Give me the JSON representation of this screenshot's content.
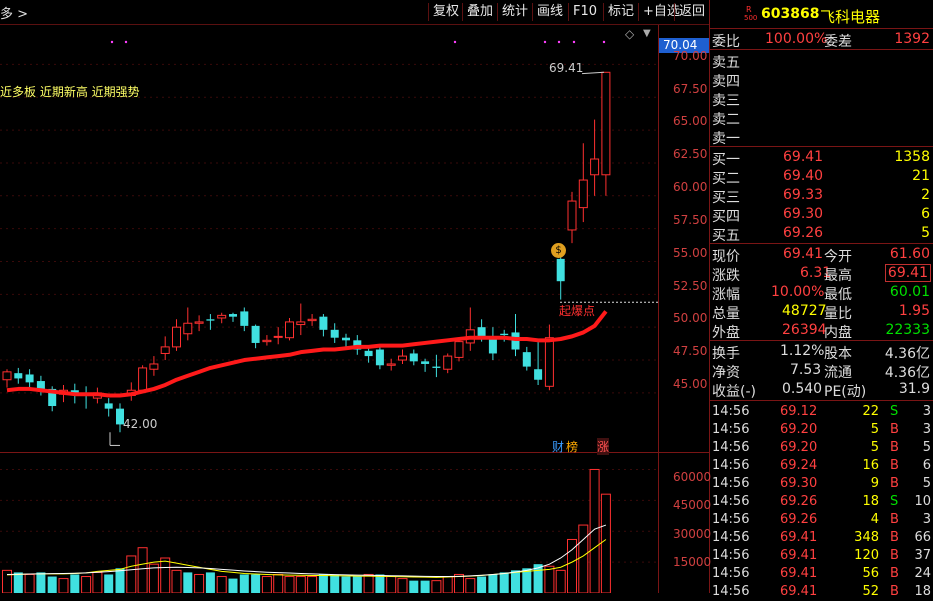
{
  "toolbar": {
    "left_label": "多 >",
    "buttons": [
      "复权",
      "叠加",
      "统计",
      "画线",
      "F10",
      "标记",
      "+自选",
      "返回"
    ]
  },
  "chart": {
    "current_price_tag": "70.04",
    "signal_text": "近多板 近期新高 近期强势",
    "high_label": "69.41",
    "low_label": "42.00",
    "breakout_label": "起爆点",
    "badge_cai": "财",
    "badge_bang": "榜",
    "badge_zhang": "涨",
    "price_axis": [
      "70.00",
      "67.50",
      "65.00",
      "62.50",
      "60.00",
      "57.50",
      "55.00",
      "52.50",
      "50.00",
      "47.50",
      "45.00"
    ],
    "volume_axis": [
      "60000",
      "45000",
      "30000",
      "15000"
    ]
  },
  "chart_data": {
    "type": "candlestick",
    "ylim": [
      42,
      71
    ],
    "candles": [
      [
        46.0,
        46.6,
        45.4,
        46.8
      ],
      [
        46.5,
        46.1,
        45.7,
        46.9
      ],
      [
        46.4,
        45.8,
        45.4,
        46.8
      ],
      [
        45.9,
        45.2,
        44.8,
        46.3
      ],
      [
        45.3,
        44.0,
        43.6,
        45.5
      ],
      [
        44.9,
        45.2,
        44.3,
        45.6
      ],
      [
        45.2,
        45.0,
        44.2,
        45.7
      ],
      [
        45.0,
        44.9,
        43.8,
        45.5
      ],
      [
        44.6,
        45.0,
        44.2,
        45.4
      ],
      [
        44.2,
        43.8,
        43.2,
        44.6
      ],
      [
        43.8,
        42.6,
        42.0,
        44.2
      ],
      [
        44.8,
        45.2,
        44.4,
        45.8
      ],
      [
        45.2,
        46.9,
        45.0,
        47.1
      ],
      [
        46.8,
        47.2,
        46.3,
        47.8
      ],
      [
        48.0,
        48.5,
        47.5,
        49.3
      ],
      [
        48.5,
        50.0,
        48.2,
        50.6
      ],
      [
        49.5,
        50.3,
        49.0,
        51.5
      ],
      [
        50.3,
        50.4,
        49.7,
        50.9
      ],
      [
        50.6,
        50.5,
        49.8,
        51.0
      ],
      [
        50.7,
        50.9,
        50.3,
        51.1
      ],
      [
        51.0,
        50.8,
        50.4,
        51.1
      ],
      [
        51.2,
        50.1,
        49.7,
        51.5
      ],
      [
        50.1,
        48.8,
        48.4,
        50.2
      ],
      [
        48.9,
        49.0,
        48.6,
        49.4
      ],
      [
        49.3,
        49.3,
        48.7,
        50.0
      ],
      [
        49.2,
        50.4,
        49.0,
        50.7
      ],
      [
        50.2,
        50.4,
        49.4,
        51.8
      ],
      [
        50.5,
        50.6,
        50.1,
        51.0
      ],
      [
        50.8,
        49.8,
        49.3,
        51.0
      ],
      [
        49.8,
        49.2,
        48.8,
        50.3
      ],
      [
        49.2,
        49.0,
        48.5,
        49.5
      ],
      [
        49.0,
        48.3,
        47.9,
        49.4
      ],
      [
        48.2,
        47.8,
        47.3,
        48.4
      ],
      [
        48.3,
        47.1,
        46.8,
        48.5
      ],
      [
        47.1,
        47.2,
        46.7,
        47.6
      ],
      [
        47.5,
        47.8,
        47.2,
        48.3
      ],
      [
        48.0,
        47.4,
        47.1,
        48.3
      ],
      [
        47.4,
        47.2,
        46.6,
        47.6
      ],
      [
        47.0,
        46.9,
        46.2,
        47.9
      ],
      [
        46.8,
        47.8,
        46.5,
        48.0
      ],
      [
        47.7,
        48.9,
        47.4,
        49.1
      ],
      [
        48.8,
        49.8,
        48.2,
        51.5
      ],
      [
        50.0,
        49.2,
        48.9,
        50.6
      ],
      [
        49.2,
        48.0,
        47.5,
        50.0
      ],
      [
        49.5,
        49.4,
        48.9,
        49.8
      ],
      [
        49.6,
        48.3,
        47.8,
        51.0
      ],
      [
        48.1,
        47.0,
        46.7,
        48.5
      ],
      [
        46.8,
        46.0,
        45.6,
        48.9
      ],
      [
        45.5,
        49.2,
        45.2,
        50.2
      ],
      [
        55.2,
        53.5,
        52.1,
        55.6
      ],
      [
        57.4,
        59.6,
        56.4,
        60.3
      ],
      [
        59.1,
        61.2,
        58.0,
        64.0
      ],
      [
        61.6,
        62.8,
        60.0,
        65.8
      ],
      [
        61.6,
        69.4,
        60.0,
        69.4
      ]
    ],
    "ma": [
      45.2,
      45.3,
      45.3,
      45.2,
      45.1,
      45.0,
      44.9,
      44.9,
      44.9,
      44.8,
      44.8,
      44.9,
      45.1,
      45.3,
      45.6,
      46.0,
      46.3,
      46.6,
      46.9,
      47.1,
      47.3,
      47.5,
      47.6,
      47.7,
      47.8,
      47.9,
      48.1,
      48.2,
      48.3,
      48.3,
      48.4,
      48.5,
      48.5,
      48.6,
      48.6,
      48.6,
      48.7,
      48.8,
      48.9,
      49.0,
      49.1,
      49.2,
      49.2,
      49.2,
      49.2,
      49.1,
      49.1,
      49.0,
      49.0,
      49.1,
      49.3,
      49.6,
      50.1,
      51.2
    ],
    "volumes": [
      [
        11000,
        1
      ],
      [
        10000,
        0
      ],
      [
        9000,
        1
      ],
      [
        10000,
        0
      ],
      [
        8000,
        0
      ],
      [
        7000,
        1
      ],
      [
        9000,
        0
      ],
      [
        8000,
        1
      ],
      [
        10000,
        1
      ],
      [
        9000,
        0
      ],
      [
        12000,
        0
      ],
      [
        18000,
        1
      ],
      [
        22000,
        1
      ],
      [
        14000,
        1
      ],
      [
        17000,
        1
      ],
      [
        11000,
        1
      ],
      [
        10000,
        0
      ],
      [
        9000,
        1
      ],
      [
        10000,
        0
      ],
      [
        8000,
        1
      ],
      [
        7000,
        0
      ],
      [
        9000,
        0
      ],
      [
        9000,
        0
      ],
      [
        8000,
        1
      ],
      [
        9000,
        1
      ],
      [
        8000,
        1
      ],
      [
        8000,
        1
      ],
      [
        8000,
        1
      ],
      [
        9000,
        0
      ],
      [
        9000,
        0
      ],
      [
        8000,
        0
      ],
      [
        8000,
        0
      ],
      [
        9000,
        1
      ],
      [
        9000,
        0
      ],
      [
        8000,
        1
      ],
      [
        7000,
        1
      ],
      [
        6000,
        0
      ],
      [
        6000,
        0
      ],
      [
        6000,
        1
      ],
      [
        8000,
        1
      ],
      [
        9000,
        1
      ],
      [
        7000,
        1
      ],
      [
        8000,
        0
      ],
      [
        9000,
        0
      ],
      [
        10000,
        0
      ],
      [
        11000,
        0
      ],
      [
        12000,
        0
      ],
      [
        14000,
        0
      ],
      [
        13000,
        1
      ],
      [
        11000,
        1
      ],
      [
        26000,
        1
      ],
      [
        33000,
        1
      ],
      [
        60000,
        1
      ],
      [
        48000,
        1
      ]
    ],
    "vol_ma_yellow": [
      8800,
      9000,
      9200,
      9300,
      9300,
      9300,
      9500,
      9800,
      10500,
      11000,
      11500,
      13000,
      14000,
      15000,
      15500,
      14500,
      13500,
      12500,
      11500,
      10500,
      10000,
      9500,
      9200,
      9000,
      8800,
      8700,
      8600,
      8500,
      8500,
      8400,
      8300,
      8200,
      8200,
      8100,
      8000,
      7900,
      7800,
      7700,
      7600,
      7800,
      8000,
      8200,
      8500,
      9000,
      9500,
      10000,
      10500,
      11000,
      11500,
      12500,
      15000,
      18000,
      22000,
      26000
    ],
    "vol_ma_white": [
      9000,
      9100,
      9200,
      9300,
      9400,
      9500,
      9600,
      9800,
      10100,
      10400,
      10800,
      11300,
      11800,
      12200,
      12400,
      12500,
      12400,
      12200,
      11900,
      11500,
      11100,
      10700,
      10400,
      10100,
      9900,
      9700,
      9500,
      9300,
      9100,
      8900,
      8800,
      8700,
      8600,
      8500,
      8400,
      8300,
      8200,
      8100,
      8000,
      8000,
      8100,
      8300,
      8600,
      9000,
      9500,
      10200,
      11000,
      12200,
      14000,
      17000,
      21000,
      26000,
      31000,
      33000
    ]
  },
  "quote": {
    "badge_r": "R",
    "badge_num": "500",
    "code": "603868",
    "name": "飞科电器",
    "weibi_label": "委比",
    "weibi_value": "100.00%",
    "weicha_label": "委差",
    "weicha_value": "1392",
    "sell": [
      {
        "label": "卖五",
        "price": "",
        "vol": ""
      },
      {
        "label": "卖四",
        "price": "",
        "vol": ""
      },
      {
        "label": "卖三",
        "price": "",
        "vol": ""
      },
      {
        "label": "卖二",
        "price": "",
        "vol": ""
      },
      {
        "label": "卖一",
        "price": "",
        "vol": ""
      }
    ],
    "buy": [
      {
        "label": "买一",
        "price": "69.41",
        "vol": "1358"
      },
      {
        "label": "买二",
        "price": "69.40",
        "vol": "21"
      },
      {
        "label": "买三",
        "price": "69.33",
        "vol": "2"
      },
      {
        "label": "买四",
        "price": "69.30",
        "vol": "6"
      },
      {
        "label": "买五",
        "price": "69.26",
        "vol": "5"
      }
    ],
    "stats": [
      {
        "l1": "现价",
        "v1": "69.41",
        "c1": "#ff4040",
        "l2": "今开",
        "v2": "61.60",
        "c2": "#ff4040"
      },
      {
        "l1": "涨跌",
        "v1": "6.31",
        "c1": "#ff4040",
        "l2": "最高",
        "v2": "69.41",
        "c2": "#ff4040"
      },
      {
        "l1": "涨幅",
        "v1": "10.00%",
        "c1": "#ff4040",
        "l2": "最低",
        "v2": "60.01",
        "c2": "#00e000"
      },
      {
        "l1": "总量",
        "v1": "48727",
        "c1": "#ffff00",
        "l2": "量比",
        "v2": "1.95",
        "c2": "#ff4040"
      },
      {
        "l1": "外盘",
        "v1": "26394",
        "c1": "#ff4040",
        "l2": "内盘",
        "v2": "22333",
        "c2": "#00e000"
      }
    ],
    "stats2": [
      {
        "l1": "换手",
        "v1": "1.12%",
        "l2": "股本",
        "v2": "4.36亿"
      },
      {
        "l1": "净资",
        "v1": "7.53",
        "l2": "流通",
        "v2": "4.36亿"
      },
      {
        "l1": "收益(-)",
        "v1": "0.540",
        "l2": "PE(动)",
        "v2": "31.9"
      }
    ],
    "ticks": [
      {
        "time": "14:56",
        "price": "69.12",
        "vol": "22",
        "side": "S",
        "n": "3"
      },
      {
        "time": "14:56",
        "price": "69.20",
        "vol": "5",
        "side": "B",
        "n": "3"
      },
      {
        "time": "14:56",
        "price": "69.20",
        "vol": "5",
        "side": "B",
        "n": "5"
      },
      {
        "time": "14:56",
        "price": "69.24",
        "vol": "16",
        "side": "B",
        "n": "6"
      },
      {
        "time": "14:56",
        "price": "69.30",
        "vol": "9",
        "side": "B",
        "n": "5"
      },
      {
        "time": "14:56",
        "price": "69.26",
        "vol": "18",
        "side": "S",
        "n": "10"
      },
      {
        "time": "14:56",
        "price": "69.26",
        "vol": "4",
        "side": "B",
        "n": "3"
      },
      {
        "time": "14:56",
        "price": "69.41",
        "vol": "348",
        "side": "B",
        "n": "66"
      },
      {
        "time": "14:56",
        "price": "69.41",
        "vol": "120",
        "side": "B",
        "n": "37"
      },
      {
        "time": "14:56",
        "price": "69.41",
        "vol": "56",
        "side": "B",
        "n": "24"
      },
      {
        "time": "14:56",
        "price": "69.41",
        "vol": "52",
        "side": "B",
        "n": "18"
      }
    ]
  }
}
